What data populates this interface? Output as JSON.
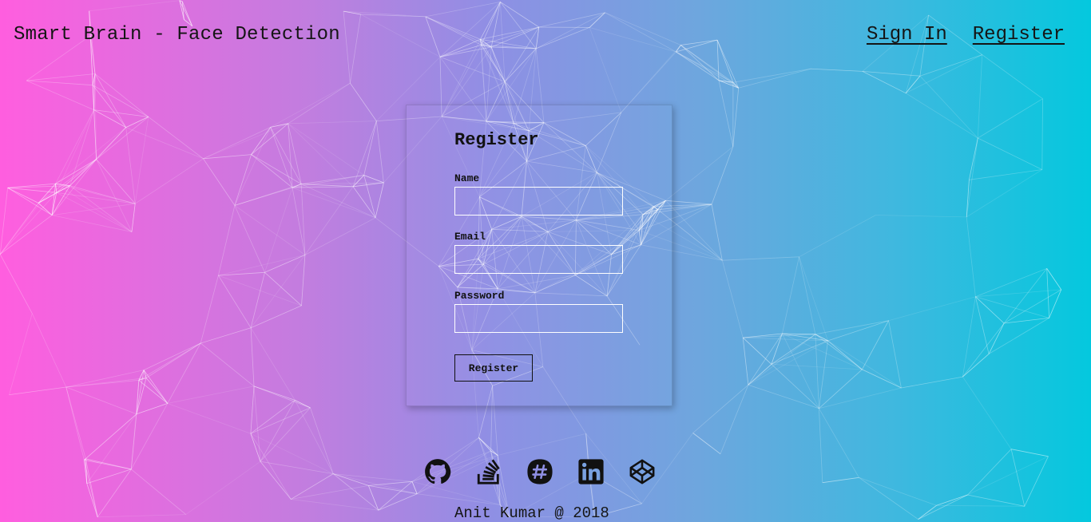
{
  "header": {
    "brand": "Smart Brain - Face Detection",
    "nav": {
      "sign_in": "Sign In",
      "register": "Register"
    }
  },
  "form": {
    "title": "Register",
    "fields": [
      {
        "label": "Name",
        "value": "",
        "type": "text"
      },
      {
        "label": "Email",
        "value": "",
        "type": "email"
      },
      {
        "label": "Password",
        "value": "",
        "type": "password"
      }
    ],
    "submit_label": "Register"
  },
  "social_links": [
    {
      "icon": "github-icon"
    },
    {
      "icon": "stackoverflow-icon"
    },
    {
      "icon": "slack-icon"
    },
    {
      "icon": "linkedin-icon"
    },
    {
      "icon": "codepen-icon"
    }
  ],
  "footer": {
    "text": "Anit Kumar @ 2018"
  },
  "colors": {
    "gradient_left": "#ff5edf",
    "gradient_mid": "#8f8fe4",
    "gradient_right": "#04c8de",
    "text": "#151515",
    "network_lines": "#ffffff"
  }
}
